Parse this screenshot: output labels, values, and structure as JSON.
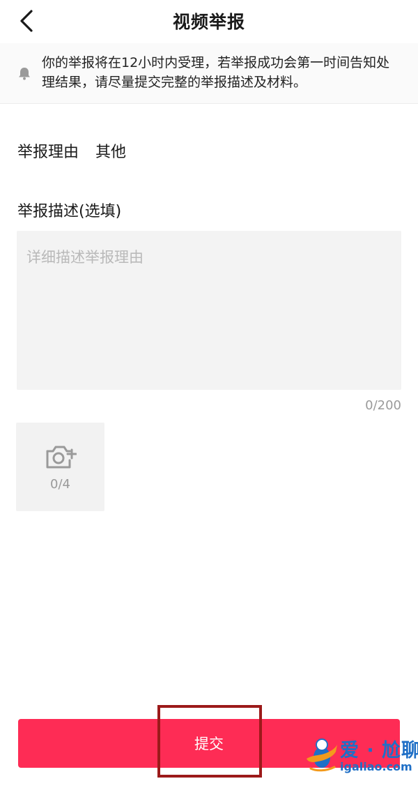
{
  "header": {
    "title": "视频举报"
  },
  "notice": {
    "text": "你的举报将在12小时内受理，若举报成功会第一时间告知处理结果，请尽量提交完整的举报描述及材料。"
  },
  "form": {
    "reason_label": "举报理由",
    "reason_value": "其他",
    "description_label": "举报描述(选填)",
    "description_placeholder": "详细描述举报理由",
    "description_counter": "0/200",
    "upload_counter": "0/4"
  },
  "submit": {
    "label": "提交"
  },
  "watermark": {
    "title": "爱 · 尬聊",
    "url": "igaliao.com"
  },
  "colors": {
    "accent": "#fe2c55",
    "highlight_box": "#9c1a1a",
    "watermark_blue": "#1f6fc6",
    "watermark_orange": "#f39a1c"
  },
  "icons": {
    "back": "chevron-left-icon",
    "notice": "bell-icon",
    "upload": "camera-plus-icon"
  }
}
